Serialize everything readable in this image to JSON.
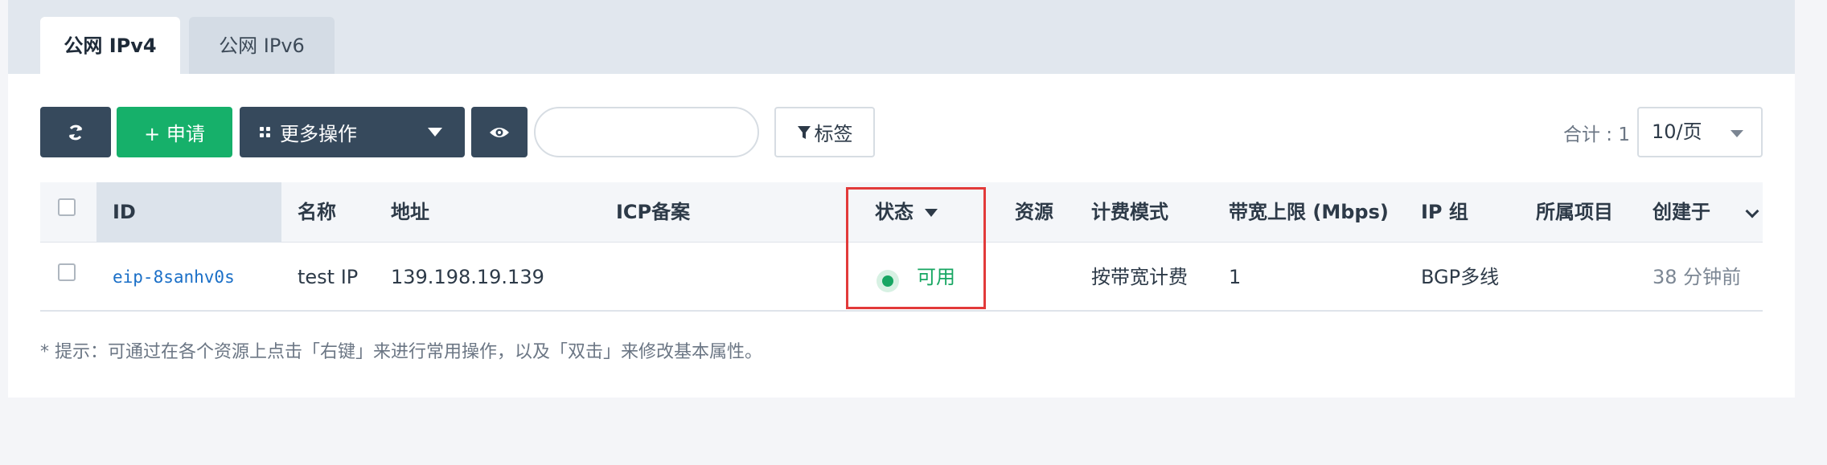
{
  "tabs": [
    {
      "label": "公网 IPv4",
      "active": true
    },
    {
      "label": "公网 IPv6",
      "active": false
    }
  ],
  "toolbar": {
    "refresh_icon": "refresh-icon",
    "apply_label": "+ 申请",
    "more_label": "更多操作",
    "more_icon": "grid-icon",
    "eye_icon": "eye-icon",
    "search_value": "",
    "search_placeholder": "",
    "tag_label": "标签",
    "tag_icon": "filter-icon"
  },
  "pagination": {
    "total_label": "合计 : 1",
    "page_size": "10/页"
  },
  "table": {
    "columns": {
      "id": "ID",
      "name": "名称",
      "address": "地址",
      "icp": "ICP备案",
      "status": "状态",
      "resource": "资源",
      "billing": "计费模式",
      "bandwidth": "带宽上限 (Mbps)",
      "ip_group": "IP 组",
      "project": "所属项目",
      "created": "创建于"
    },
    "rows": [
      {
        "id": "eip-8sanhv0s",
        "name": "test IP",
        "address": "139.198.19.139",
        "icp": "",
        "status": "可用",
        "resource": "",
        "billing": "按带宽计费",
        "bandwidth": "1",
        "ip_group": "BGP多线",
        "project": "",
        "created": "38 分钟前"
      }
    ]
  },
  "hint": "* 提示：可通过在各个资源上点击「右键」来进行常用操作，以及「双击」来修改基本属性。",
  "colors": {
    "primary_dark": "#36495c",
    "success": "#16b06a",
    "link": "#1a6fc7",
    "highlight": "#e23a3a"
  }
}
